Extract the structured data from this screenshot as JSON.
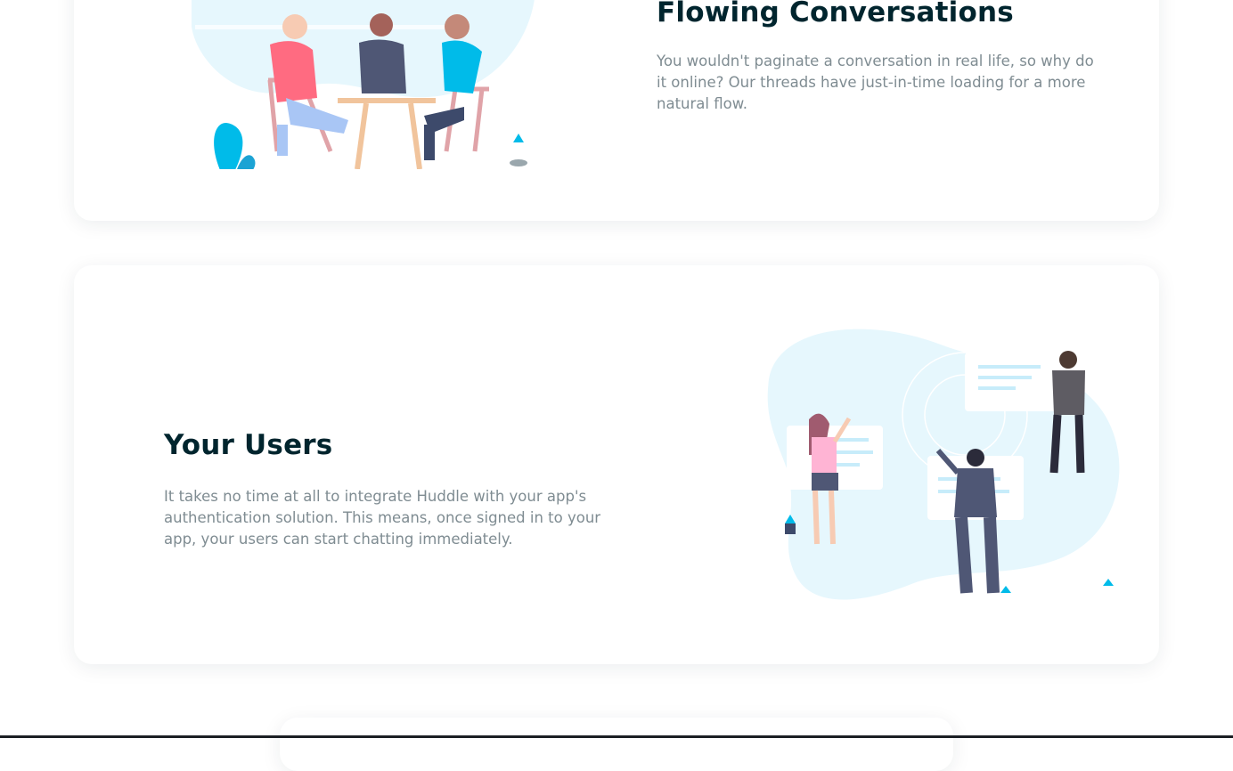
{
  "features": [
    {
      "title": "Flowing Conversations",
      "text": "You wouldn't paginate a conversation in real life, so why do it online? Our threads have just-in-time loading for a more natural flow.",
      "illustration": "people-at-table-illustration"
    },
    {
      "title": "Your Users",
      "text": "It takes no time at all to integrate Huddle with your app's authentication solution. This means, once signed in to your app, your users can start chatting immediately.",
      "illustration": "people-with-chat-bubbles-illustration"
    }
  ],
  "colors": {
    "heading": "#00252e",
    "body_text": "#7f8c92",
    "accent_blue": "#00bbe9",
    "blob": "#e6f7fd"
  }
}
